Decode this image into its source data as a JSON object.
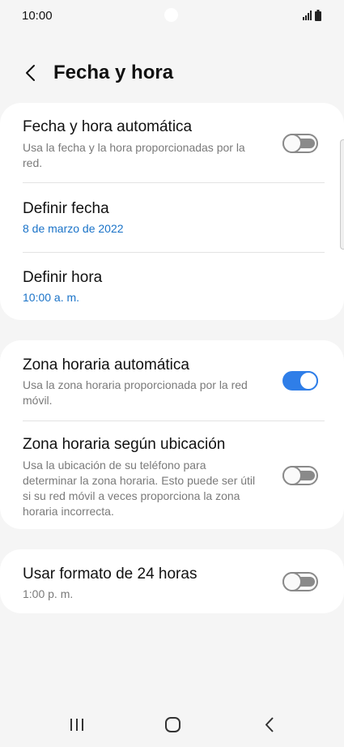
{
  "status_bar": {
    "time": "10:00",
    "icons": [
      "signal-icon",
      "battery-icon"
    ]
  },
  "header": {
    "back_icon": "chevron-left-icon",
    "title": "Fecha y hora"
  },
  "section1": {
    "auto_datetime": {
      "title": "Fecha y hora automática",
      "subtitle": "Usa la fecha y la hora proporcionadas por la red.",
      "enabled": false
    },
    "set_date": {
      "title": "Definir fecha",
      "value": "8 de marzo de 2022"
    },
    "set_time": {
      "title": "Definir hora",
      "value": "10:00 a. m."
    }
  },
  "section2": {
    "auto_timezone": {
      "title": "Zona horaria automática",
      "subtitle": "Usa la zona horaria proporcionada por la red móvil.",
      "enabled": true
    },
    "location_timezone": {
      "title": "Zona horaria según ubicación",
      "subtitle": "Usa la ubicación de su teléfono para determinar la zona horaria. Esto puede ser útil si su red móvil a veces proporciona la zona horaria incorrecta.",
      "enabled": false
    }
  },
  "section3": {
    "format24": {
      "title": "Usar formato de 24 horas",
      "subtitle": "1:00 p. m.",
      "enabled": false
    }
  },
  "colors": {
    "accent": "#2f7ee8",
    "value_blue": "#1a73c8",
    "background": "#f5f5f5",
    "card": "#ffffff"
  },
  "nav_bar": {
    "icons": [
      "recent-apps-icon",
      "home-icon",
      "back-icon"
    ]
  }
}
